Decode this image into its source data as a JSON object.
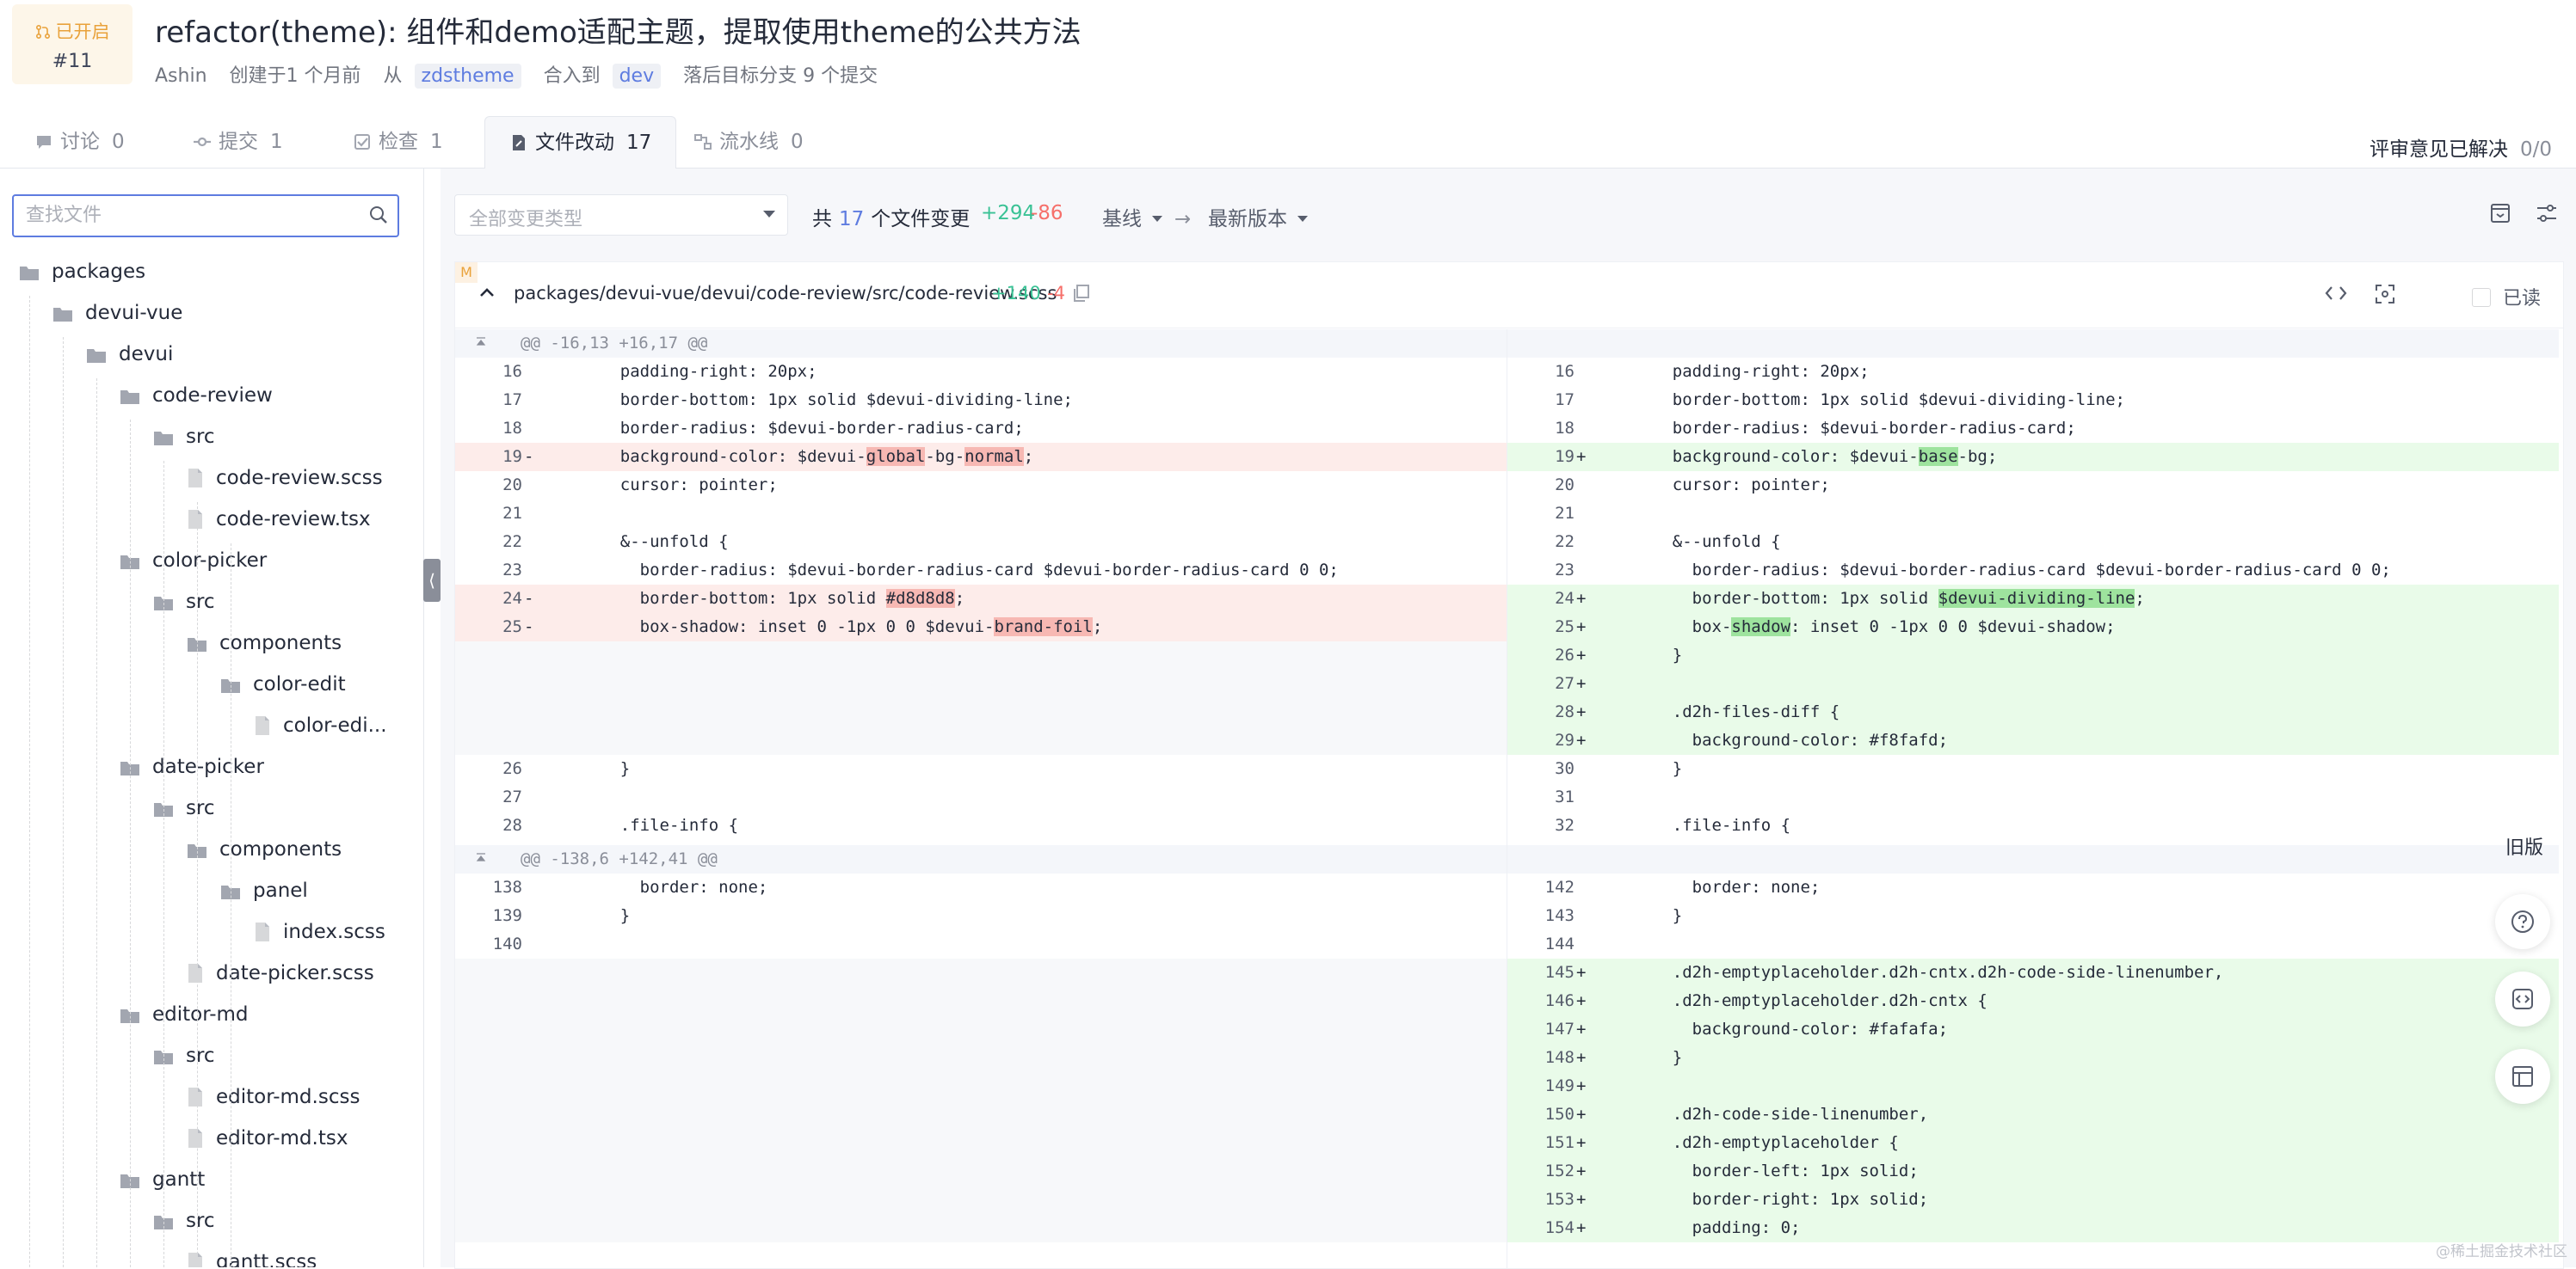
{
  "pr": {
    "status": "已开启",
    "number": "#11",
    "title": "refactor(theme): 组件和demo适配主题，提取使用theme的公共方法",
    "author": "Ashin",
    "created": "创建于1 个月前",
    "from_label": "从",
    "source_branch": "zdstheme",
    "merge_label": "合入到",
    "target_branch": "dev",
    "behind": "落后目标分支 9 个提交"
  },
  "tabs": [
    {
      "label": "讨论",
      "count": "0",
      "icon": "comment-icon"
    },
    {
      "label": "提交",
      "count": "1",
      "icon": "commit-icon"
    },
    {
      "label": "检查",
      "count": "1",
      "icon": "check-icon"
    },
    {
      "label": "文件改动",
      "count": "17",
      "icon": "file-edit-icon"
    },
    {
      "label": "流水线",
      "count": "0",
      "icon": "pipeline-icon"
    }
  ],
  "review": {
    "label": "评审意见已解决",
    "count": "0/0"
  },
  "sidebar": {
    "search_placeholder": "查找文件",
    "tree": [
      {
        "name": "packages",
        "type": "folder",
        "depth": 0
      },
      {
        "name": "devui-vue",
        "type": "folder",
        "depth": 1
      },
      {
        "name": "devui",
        "type": "folder",
        "depth": 2
      },
      {
        "name": "code-review",
        "type": "folder",
        "depth": 3
      },
      {
        "name": "src",
        "type": "folder",
        "depth": 4
      },
      {
        "name": "code-review.scss",
        "type": "file",
        "depth": 5
      },
      {
        "name": "code-review.tsx",
        "type": "file",
        "depth": 5
      },
      {
        "name": "color-picker",
        "type": "folder",
        "depth": 3
      },
      {
        "name": "src",
        "type": "folder",
        "depth": 4
      },
      {
        "name": "components",
        "type": "folder",
        "depth": 5
      },
      {
        "name": "color-edit",
        "type": "folder",
        "depth": 6
      },
      {
        "name": "color-edi...",
        "type": "file",
        "depth": 7
      },
      {
        "name": "date-picker",
        "type": "folder",
        "depth": 3
      },
      {
        "name": "src",
        "type": "folder",
        "depth": 4
      },
      {
        "name": "components",
        "type": "folder",
        "depth": 5
      },
      {
        "name": "panel",
        "type": "folder",
        "depth": 6
      },
      {
        "name": "index.scss",
        "type": "file",
        "depth": 7
      },
      {
        "name": "date-picker.scss",
        "type": "file",
        "depth": 5
      },
      {
        "name": "editor-md",
        "type": "folder",
        "depth": 3
      },
      {
        "name": "src",
        "type": "folder",
        "depth": 4
      },
      {
        "name": "editor-md.scss",
        "type": "file",
        "depth": 5
      },
      {
        "name": "editor-md.tsx",
        "type": "file",
        "depth": 5
      },
      {
        "name": "gantt",
        "type": "folder",
        "depth": 3
      },
      {
        "name": "src",
        "type": "folder",
        "depth": 4
      },
      {
        "name": "gantt.scss",
        "type": "file",
        "depth": 5
      }
    ]
  },
  "toolbar": {
    "type_placeholder": "全部变更类型",
    "count_prefix": "共",
    "count": "17",
    "count_suffix": "个文件变更",
    "additions": "+294",
    "deletions": "-86",
    "base": "基线",
    "target": "最新版本"
  },
  "file": {
    "badge": "M",
    "path": "packages/devui-vue/devui/code-review/src/code-review.scss",
    "additions": "+140",
    "deletions": "-4",
    "viewed_label": "已读"
  },
  "diff": {
    "left": [
      {
        "t": "hunk",
        "code": "@@ -16,13 +16,17 @@"
      },
      {
        "t": "ctx",
        "ln": "16",
        "code": "    padding-right: 20px;"
      },
      {
        "t": "ctx",
        "ln": "17",
        "code": "    border-bottom: 1px solid $devui-dividing-line;"
      },
      {
        "t": "ctx",
        "ln": "18",
        "code": "    border-radius: $devui-border-radius-card;"
      },
      {
        "t": "del",
        "ln": "19",
        "mk": "-",
        "code": "    background-color: $devui-global-bg-normal;"
      },
      {
        "t": "ctx",
        "ln": "20",
        "code": "    cursor: pointer;"
      },
      {
        "t": "ctx",
        "ln": "21",
        "code": ""
      },
      {
        "t": "ctx",
        "ln": "22",
        "code": "    &--unfold {"
      },
      {
        "t": "ctx",
        "ln": "23",
        "code": "      border-radius: $devui-border-radius-card $devui-border-radius-card 0 0;"
      },
      {
        "t": "del",
        "ln": "24",
        "mk": "-",
        "code": "      border-bottom: 1px solid #d8d8d8;"
      },
      {
        "t": "del",
        "ln": "25",
        "mk": "-",
        "code": "      box-shadow: inset 0 -1px 0 0 $devui-brand-foil;"
      },
      {
        "t": "filler"
      },
      {
        "t": "filler"
      },
      {
        "t": "filler"
      },
      {
        "t": "filler"
      },
      {
        "t": "ctx",
        "ln": "26",
        "code": "    }"
      },
      {
        "t": "ctx",
        "ln": "27",
        "code": ""
      },
      {
        "t": "ctx",
        "ln": "28",
        "code": "    .file-info {"
      },
      {
        "t": "hunk",
        "code": "@@ -138,6 +142,41 @@"
      },
      {
        "t": "ctx",
        "ln": "138",
        "code": "      border: none;"
      },
      {
        "t": "ctx",
        "ln": "139",
        "code": "    }"
      },
      {
        "t": "ctx",
        "ln": "140",
        "code": ""
      },
      {
        "t": "filler"
      },
      {
        "t": "filler"
      },
      {
        "t": "filler"
      },
      {
        "t": "filler"
      },
      {
        "t": "filler"
      },
      {
        "t": "filler"
      },
      {
        "t": "filler"
      },
      {
        "t": "filler"
      },
      {
        "t": "filler"
      },
      {
        "t": "filler"
      }
    ],
    "right": [
      {
        "t": "hunk",
        "code": ""
      },
      {
        "t": "ctx",
        "ln": "16",
        "code": "    padding-right: 20px;"
      },
      {
        "t": "ctx",
        "ln": "17",
        "code": "    border-bottom: 1px solid $devui-dividing-line;"
      },
      {
        "t": "ctx",
        "ln": "18",
        "code": "    border-radius: $devui-border-radius-card;"
      },
      {
        "t": "add",
        "ln": "19",
        "mk": "+",
        "code": "    background-color: $devui-base-bg;"
      },
      {
        "t": "ctx",
        "ln": "20",
        "code": "    cursor: pointer;"
      },
      {
        "t": "ctx",
        "ln": "21",
        "code": ""
      },
      {
        "t": "ctx",
        "ln": "22",
        "code": "    &--unfold {"
      },
      {
        "t": "ctx",
        "ln": "23",
        "code": "      border-radius: $devui-border-radius-card $devui-border-radius-card 0 0;"
      },
      {
        "t": "add",
        "ln": "24",
        "mk": "+",
        "code": "      border-bottom: 1px solid $devui-dividing-line;"
      },
      {
        "t": "add",
        "ln": "25",
        "mk": "+",
        "code": "      box-shadow: inset 0 -1px 0 0 $devui-shadow;"
      },
      {
        "t": "add",
        "ln": "26",
        "mk": "+",
        "code": "    }"
      },
      {
        "t": "add",
        "ln": "27",
        "mk": "+",
        "code": ""
      },
      {
        "t": "add",
        "ln": "28",
        "mk": "+",
        "code": "    .d2h-files-diff {"
      },
      {
        "t": "add",
        "ln": "29",
        "mk": "+",
        "code": "      background-color: #f8fafd;"
      },
      {
        "t": "ctx",
        "ln": "30",
        "code": "    }"
      },
      {
        "t": "ctx",
        "ln": "31",
        "code": ""
      },
      {
        "t": "ctx",
        "ln": "32",
        "code": "    .file-info {"
      },
      {
        "t": "hunk",
        "code": ""
      },
      {
        "t": "ctx",
        "ln": "142",
        "code": "      border: none;"
      },
      {
        "t": "ctx",
        "ln": "143",
        "code": "    }"
      },
      {
        "t": "ctx",
        "ln": "144",
        "code": ""
      },
      {
        "t": "add",
        "ln": "145",
        "mk": "+",
        "code": "    .d2h-emptyplaceholder.d2h-cntx.d2h-code-side-linenumber,"
      },
      {
        "t": "add",
        "ln": "146",
        "mk": "+",
        "code": "    .d2h-emptyplaceholder.d2h-cntx {"
      },
      {
        "t": "add",
        "ln": "147",
        "mk": "+",
        "code": "      background-color: #fafafa;"
      },
      {
        "t": "add",
        "ln": "148",
        "mk": "+",
        "code": "    }"
      },
      {
        "t": "add",
        "ln": "149",
        "mk": "+",
        "code": ""
      },
      {
        "t": "add",
        "ln": "150",
        "mk": "+",
        "code": "    .d2h-code-side-linenumber,"
      },
      {
        "t": "add",
        "ln": "151",
        "mk": "+",
        "code": "    .d2h-emptyplaceholder {"
      },
      {
        "t": "add",
        "ln": "152",
        "mk": "+",
        "code": "      border-left: 1px solid;"
      },
      {
        "t": "add",
        "ln": "153",
        "mk": "+",
        "code": "      border-right: 1px solid;"
      },
      {
        "t": "add",
        "ln": "154",
        "mk": "+",
        "code": "      padding: 0;"
      }
    ],
    "highlights": {
      "left_19": [
        "global",
        "normal"
      ],
      "left_24": [
        "#d8d8d8"
      ],
      "left_25": [
        "brand-foil"
      ],
      "right_19": [
        "base"
      ],
      "right_24": [
        "$devui-dividing-line"
      ],
      "right_25": [
        "shadow"
      ]
    }
  },
  "floating": {
    "old_version": "旧版"
  },
  "watermark": "@稀土掘金技术社区",
  "colors": {
    "brand": "#5e7ce0",
    "add": "#3ac295",
    "del": "#f66f6a",
    "add_bg": "#e9fbe9",
    "del_bg": "#fdecea"
  }
}
